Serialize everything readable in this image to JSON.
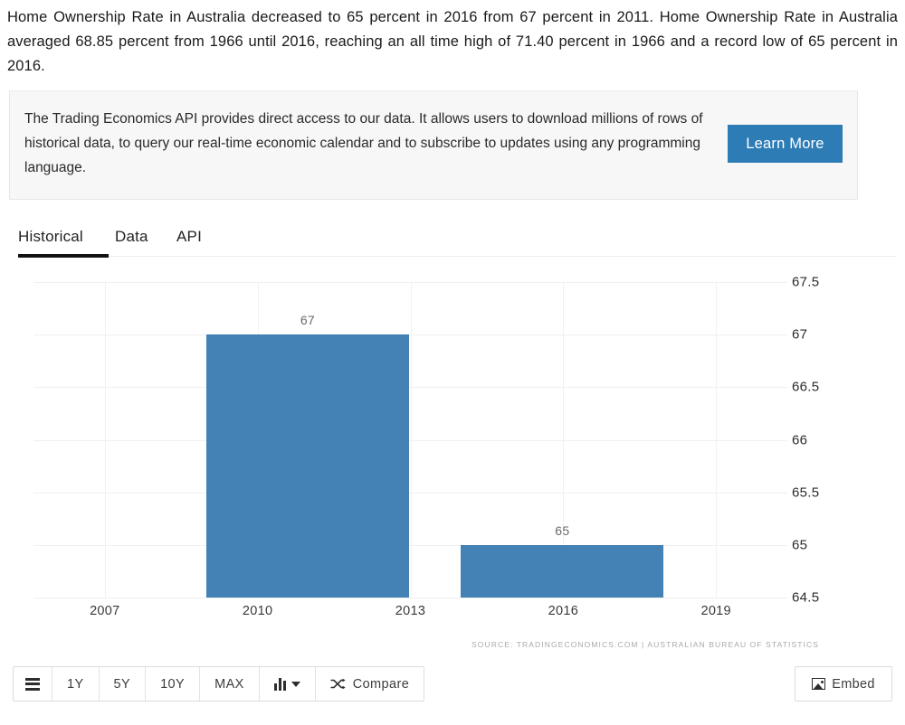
{
  "intro": {
    "paragraph": "Home Ownership Rate in Australia decreased to 65 percent in 2016 from 67 percent in 2011. Home Ownership Rate in Australia averaged 68.85 percent from 1966 until 2016, reaching an all time high of 71.40 percent in 1966 and a record low of 65 percent in 2016."
  },
  "promo": {
    "text": "The Trading Economics API provides direct access to our data. It allows users to download millions of rows of historical data, to query our real-time economic calendar and to subscribe to updates using any programming language.",
    "button_label": "Learn More",
    "button_color": "#2e7cb5"
  },
  "tabs": {
    "items": [
      {
        "label": "Historical",
        "active": true
      },
      {
        "label": "Data",
        "active": false
      },
      {
        "label": "API",
        "active": false
      }
    ]
  },
  "chart_data": {
    "type": "bar",
    "title": "",
    "xlabel": "",
    "ylabel": "",
    "categories": [
      "2011",
      "2016"
    ],
    "values": [
      67,
      65
    ],
    "data_labels": [
      "67",
      "65"
    ],
    "bar_color": "#4481b4",
    "ylim": [
      64.5,
      67.5
    ],
    "yticks": [
      "67.5",
      "67",
      "66.5",
      "66",
      "65.5",
      "65",
      "64.5"
    ],
    "ytick_values": [
      67.5,
      67,
      66.5,
      66,
      65.5,
      65,
      64.5
    ],
    "xticks": [
      "2007",
      "2010",
      "2013",
      "2016",
      "2019"
    ],
    "xtick_values": [
      2007,
      2010,
      2013,
      2016,
      2019
    ],
    "xlim": [
      2005.6,
      2020.4
    ],
    "grid": true,
    "legend": false
  },
  "source": {
    "text": "SOURCE: TRADINGECONOMICS.COM  |  AUSTRALIAN BUREAU OF STATISTICS"
  },
  "toolbar": {
    "menu_icon": "list-menu-icon",
    "ranges": [
      "1Y",
      "5Y",
      "10Y",
      "MAX"
    ],
    "chart_type_icon": "bar-chart-icon",
    "compare_label": "Compare",
    "compare_icon": "shuffle-icon",
    "embed_label": "Embed",
    "embed_icon": "image-icon"
  }
}
